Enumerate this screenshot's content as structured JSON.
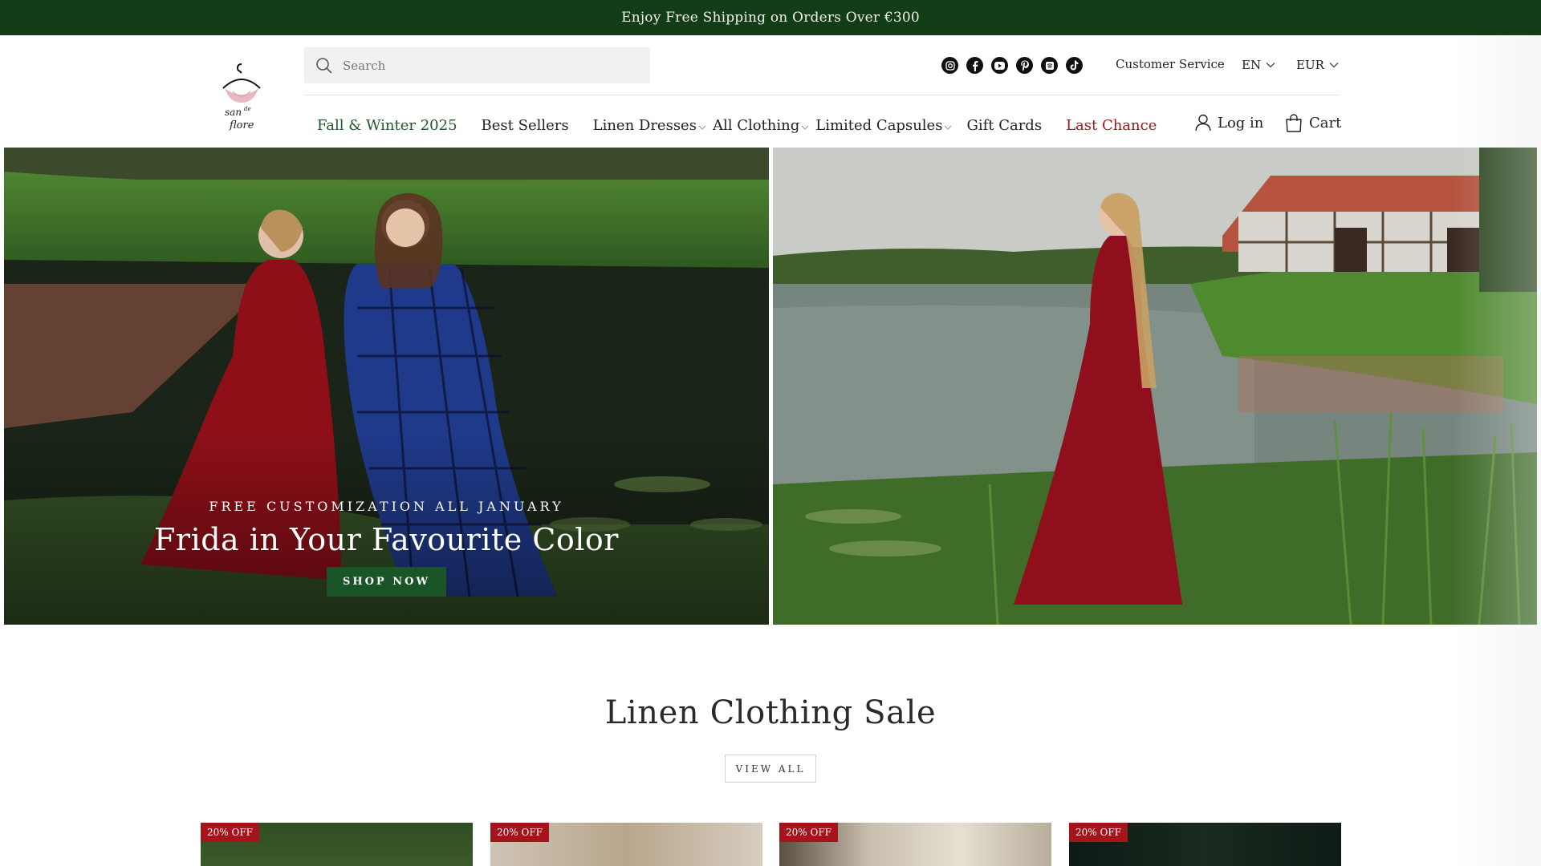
{
  "announcement": "Enjoy Free Shipping on Orders Over €300",
  "logo_text": "san de flore",
  "search": {
    "placeholder": "Search"
  },
  "socials": [
    "instagram-icon",
    "facebook-icon",
    "youtube-icon",
    "pinterest-icon",
    "spotify-icon",
    "tiktok-icon"
  ],
  "utility": {
    "customer_service": "Customer Service",
    "language": "EN",
    "currency": "EUR"
  },
  "nav": [
    {
      "label": "Fall & Winter 2025",
      "style": "green"
    },
    {
      "label": "Best Sellers"
    },
    {
      "label": "Linen Dresses",
      "dropdown": true
    },
    {
      "label": "All Clothing",
      "dropdown": true
    },
    {
      "label": "Limited Capsules",
      "dropdown": true
    },
    {
      "label": "Gift Cards"
    },
    {
      "label": "Last Chance",
      "style": "red"
    }
  ],
  "account": {
    "login": "Log in",
    "cart": "Cart"
  },
  "hero": {
    "eyebrow": "FREE CUSTOMIZATION ALL JANUARY",
    "headline": "Frida in Your Favourite Color",
    "cta": "SHOP NOW"
  },
  "section": {
    "title": "Linen Clothing Sale",
    "view_all": "VIEW ALL"
  },
  "products": [
    {
      "badge": "20% OFF"
    },
    {
      "badge": "20% OFF"
    },
    {
      "badge": "20% OFF"
    },
    {
      "badge": "20% OFF"
    }
  ],
  "colors": {
    "brand_green": "#123d17",
    "button_green": "#1a5527",
    "sale_red": "#a5141b",
    "last_chance_red": "#a4161a"
  }
}
